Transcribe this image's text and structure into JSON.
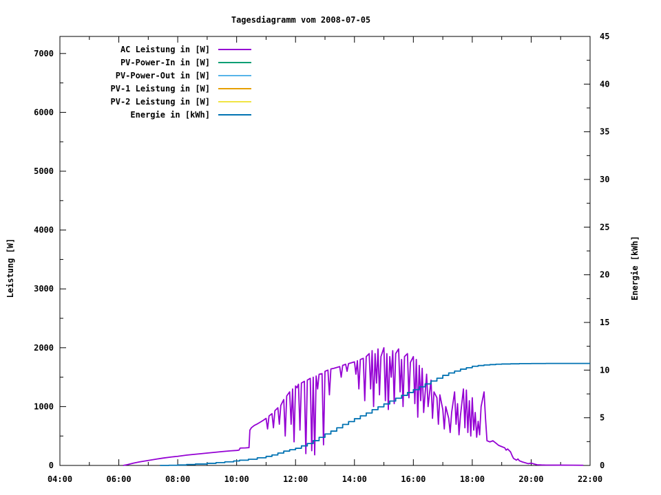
{
  "page": {
    "background": "#ffffff",
    "text_color": "#000000"
  },
  "chart": {
    "title": "Tagesdiagramm vom 2008-07-05",
    "ylabel_left": "Leistung [W]",
    "ylabel_right": "Energie [kWh]"
  },
  "legend": {
    "items": [
      {
        "label": "AC Leistung in [W]",
        "color": "#9400d3"
      },
      {
        "label": "PV-Power-In in [W]",
        "color": "#009e73"
      },
      {
        "label": "PV-Power-Out in [W]",
        "color": "#56b4e9"
      },
      {
        "label": "PV-1 Leistung in [W]",
        "color": "#e69f00"
      },
      {
        "label": "PV-2 Leistung in [W]",
        "color": "#f0e442"
      },
      {
        "label": "Energie in [kWh]",
        "color": "#0072b2"
      }
    ]
  },
  "chart_data": {
    "type": "line",
    "title": "Tagesdiagramm vom 2008-07-05",
    "xlabel": "",
    "ylabel_left": "Leistung [W]",
    "ylabel_right": "Energie [kWh]",
    "xlim_hours": [
      4,
      22
    ],
    "x_tick_labels": [
      "04:00",
      "06:00",
      "08:00",
      "10:00",
      "12:00",
      "14:00",
      "16:00",
      "18:00",
      "20:00",
      "22:00"
    ],
    "x_major_step_hours": 2,
    "x_minor_step_hours": 1,
    "ylim_left": [
      0,
      7290
    ],
    "left_tick_values": [
      0,
      1000,
      2000,
      3000,
      4000,
      5000,
      6000,
      7000
    ],
    "left_tick_labels": [
      "0",
      "1000",
      "2000",
      "3000",
      "4000",
      "5000",
      "6000",
      "7000"
    ],
    "left_minor_step": 500,
    "ylim_right": [
      0,
      45
    ],
    "right_tick_values": [
      0,
      5,
      10,
      15,
      20,
      25,
      30,
      35,
      40,
      45
    ],
    "right_tick_labels": [
      "0",
      "5",
      "10",
      "15",
      "20",
      "25",
      "30",
      "35",
      "40",
      "45"
    ],
    "right_minor_step": 2.5,
    "grid": false,
    "legend_position": "top-left-inside",
    "series": [
      {
        "name": "AC Leistung in [W]",
        "color": "#9400d3",
        "axis": "left",
        "mode": "linear",
        "points": [
          [
            6.15,
            0
          ],
          [
            6.3,
            15
          ],
          [
            6.5,
            40
          ],
          [
            6.7,
            60
          ],
          [
            7.0,
            85
          ],
          [
            7.3,
            110
          ],
          [
            7.5,
            125
          ],
          [
            7.8,
            145
          ],
          [
            8.0,
            155
          ],
          [
            8.3,
            175
          ],
          [
            8.5,
            185
          ],
          [
            8.8,
            200
          ],
          [
            9.0,
            210
          ],
          [
            9.3,
            225
          ],
          [
            9.5,
            235
          ],
          [
            9.8,
            248
          ],
          [
            10.0,
            255
          ],
          [
            10.08,
            260
          ],
          [
            10.12,
            295
          ],
          [
            10.3,
            298
          ],
          [
            10.42,
            302
          ],
          [
            10.45,
            600
          ],
          [
            10.5,
            640
          ],
          [
            10.6,
            680
          ],
          [
            10.7,
            705
          ],
          [
            10.8,
            735
          ],
          [
            10.9,
            765
          ],
          [
            11.0,
            800
          ],
          [
            11.05,
            620
          ],
          [
            11.1,
            840
          ],
          [
            11.2,
            880
          ],
          [
            11.25,
            640
          ],
          [
            11.3,
            930
          ],
          [
            11.4,
            980
          ],
          [
            11.45,
            700
          ],
          [
            11.5,
            1020
          ],
          [
            11.6,
            1120
          ],
          [
            11.65,
            500
          ],
          [
            11.7,
            1180
          ],
          [
            11.8,
            1250
          ],
          [
            11.85,
            700
          ],
          [
            11.9,
            1300
          ],
          [
            11.95,
            400
          ],
          [
            12.0,
            1350
          ],
          [
            12.05,
            1320
          ],
          [
            12.1,
            1380
          ],
          [
            12.15,
            600
          ],
          [
            12.2,
            1400
          ],
          [
            12.3,
            1430
          ],
          [
            12.35,
            200
          ],
          [
            12.4,
            1450
          ],
          [
            12.5,
            1480
          ],
          [
            12.55,
            250
          ],
          [
            12.6,
            1500
          ],
          [
            12.65,
            180
          ],
          [
            12.7,
            1520
          ],
          [
            12.75,
            1300
          ],
          [
            12.8,
            1550
          ],
          [
            12.9,
            1560
          ],
          [
            12.95,
            350
          ],
          [
            13.0,
            1600
          ],
          [
            13.1,
            1620
          ],
          [
            13.15,
            1200
          ],
          [
            13.2,
            1640
          ],
          [
            13.3,
            1650
          ],
          [
            13.4,
            1665
          ],
          [
            13.5,
            1680
          ],
          [
            13.55,
            1500
          ],
          [
            13.6,
            1700
          ],
          [
            13.7,
            1720
          ],
          [
            13.75,
            1600
          ],
          [
            13.8,
            1730
          ],
          [
            13.9,
            1745
          ],
          [
            14.0,
            1760
          ],
          [
            14.05,
            1550
          ],
          [
            14.1,
            1780
          ],
          [
            14.15,
            1300
          ],
          [
            14.2,
            1800
          ],
          [
            14.3,
            1820
          ],
          [
            14.35,
            1100
          ],
          [
            14.4,
            1850
          ],
          [
            14.5,
            1900
          ],
          [
            14.55,
            1300
          ],
          [
            14.6,
            1950
          ],
          [
            14.65,
            1000
          ],
          [
            14.7,
            1900
          ],
          [
            14.75,
            1400
          ],
          [
            14.8,
            1980
          ],
          [
            14.85,
            1200
          ],
          [
            14.9,
            1850
          ],
          [
            15.0,
            2000
          ],
          [
            15.05,
            1100
          ],
          [
            15.1,
            1900
          ],
          [
            15.15,
            950
          ],
          [
            15.2,
            1850
          ],
          [
            15.25,
            1500
          ],
          [
            15.3,
            1950
          ],
          [
            15.35,
            1050
          ],
          [
            15.4,
            1900
          ],
          [
            15.5,
            1980
          ],
          [
            15.55,
            1250
          ],
          [
            15.6,
            1800
          ],
          [
            15.65,
            1000
          ],
          [
            15.7,
            1850
          ],
          [
            15.8,
            1900
          ],
          [
            15.85,
            1150
          ],
          [
            15.9,
            1750
          ],
          [
            16.0,
            1850
          ],
          [
            16.05,
            1050
          ],
          [
            16.1,
            1800
          ],
          [
            16.15,
            820
          ],
          [
            16.2,
            1700
          ],
          [
            16.25,
            1100
          ],
          [
            16.3,
            1650
          ],
          [
            16.35,
            900
          ],
          [
            16.45,
            1550
          ],
          [
            16.5,
            1000
          ],
          [
            16.6,
            1450
          ],
          [
            16.65,
            800
          ],
          [
            16.7,
            1250
          ],
          [
            16.8,
            1150
          ],
          [
            16.85,
            700
          ],
          [
            16.9,
            1200
          ],
          [
            17.0,
            950
          ],
          [
            17.05,
            620
          ],
          [
            17.1,
            1000
          ],
          [
            17.2,
            800
          ],
          [
            17.25,
            560
          ],
          [
            17.3,
            900
          ],
          [
            17.4,
            1250
          ],
          [
            17.45,
            700
          ],
          [
            17.5,
            1050
          ],
          [
            17.55,
            520
          ],
          [
            17.6,
            850
          ],
          [
            17.7,
            1300
          ],
          [
            17.75,
            640
          ],
          [
            17.8,
            1280
          ],
          [
            17.85,
            560
          ],
          [
            17.9,
            1100
          ],
          [
            17.95,
            500
          ],
          [
            18.0,
            1150
          ],
          [
            18.05,
            600
          ],
          [
            18.1,
            900
          ],
          [
            18.15,
            480
          ],
          [
            18.2,
            750
          ],
          [
            18.25,
            520
          ],
          [
            18.3,
            1000
          ],
          [
            18.4,
            1250
          ],
          [
            18.45,
            800
          ],
          [
            18.5,
            420
          ],
          [
            18.6,
            400
          ],
          [
            18.7,
            420
          ],
          [
            18.8,
            380
          ],
          [
            18.9,
            340
          ],
          [
            19.0,
            320
          ],
          [
            19.1,
            300
          ],
          [
            19.15,
            260
          ],
          [
            19.2,
            280
          ],
          [
            19.3,
            230
          ],
          [
            19.35,
            170
          ],
          [
            19.4,
            120
          ],
          [
            19.5,
            90
          ],
          [
            19.55,
            110
          ],
          [
            19.6,
            80
          ],
          [
            19.7,
            60
          ],
          [
            19.8,
            45
          ],
          [
            19.9,
            30
          ],
          [
            20.0,
            40
          ],
          [
            20.1,
            25
          ],
          [
            20.2,
            12
          ],
          [
            20.35,
            8
          ],
          [
            20.5,
            6
          ],
          [
            21.0,
            5
          ],
          [
            21.4,
            4
          ],
          [
            21.77,
            3
          ]
        ]
      },
      {
        "name": "Energie in [kWh]",
        "color": "#0072b2",
        "axis": "right",
        "mode": "steps",
        "points": [
          [
            7.4,
            0
          ],
          [
            7.7,
            0.02
          ],
          [
            8.0,
            0.05
          ],
          [
            8.3,
            0.1
          ],
          [
            8.6,
            0.15
          ],
          [
            9.0,
            0.22
          ],
          [
            9.3,
            0.3
          ],
          [
            9.6,
            0.38
          ],
          [
            9.9,
            0.47
          ],
          [
            10.1,
            0.55
          ],
          [
            10.4,
            0.65
          ],
          [
            10.7,
            0.8
          ],
          [
            11.0,
            0.95
          ],
          [
            11.2,
            1.1
          ],
          [
            11.4,
            1.3
          ],
          [
            11.6,
            1.5
          ],
          [
            11.8,
            1.65
          ],
          [
            12.0,
            1.8
          ],
          [
            12.2,
            2.05
          ],
          [
            12.4,
            2.3
          ],
          [
            12.6,
            2.6
          ],
          [
            12.8,
            2.95
          ],
          [
            13.0,
            3.3
          ],
          [
            13.2,
            3.6
          ],
          [
            13.4,
            3.95
          ],
          [
            13.6,
            4.3
          ],
          [
            13.8,
            4.6
          ],
          [
            14.0,
            4.9
          ],
          [
            14.2,
            5.2
          ],
          [
            14.4,
            5.5
          ],
          [
            14.6,
            5.85
          ],
          [
            14.8,
            6.15
          ],
          [
            15.0,
            6.45
          ],
          [
            15.2,
            6.75
          ],
          [
            15.4,
            7.05
          ],
          [
            15.6,
            7.35
          ],
          [
            15.8,
            7.65
          ],
          [
            16.0,
            7.95
          ],
          [
            16.2,
            8.25
          ],
          [
            16.4,
            8.55
          ],
          [
            16.6,
            8.85
          ],
          [
            16.8,
            9.15
          ],
          [
            17.0,
            9.45
          ],
          [
            17.2,
            9.7
          ],
          [
            17.4,
            9.9
          ],
          [
            17.6,
            10.1
          ],
          [
            17.8,
            10.25
          ],
          [
            18.0,
            10.4
          ],
          [
            18.2,
            10.48
          ],
          [
            18.4,
            10.54
          ],
          [
            18.6,
            10.58
          ],
          [
            18.8,
            10.62
          ],
          [
            19.0,
            10.64
          ],
          [
            19.3,
            10.66
          ],
          [
            19.6,
            10.68
          ],
          [
            20.0,
            10.69
          ],
          [
            20.5,
            10.7
          ],
          [
            21.0,
            10.7
          ],
          [
            21.5,
            10.7
          ],
          [
            22.0,
            10.7
          ]
        ]
      }
    ]
  }
}
